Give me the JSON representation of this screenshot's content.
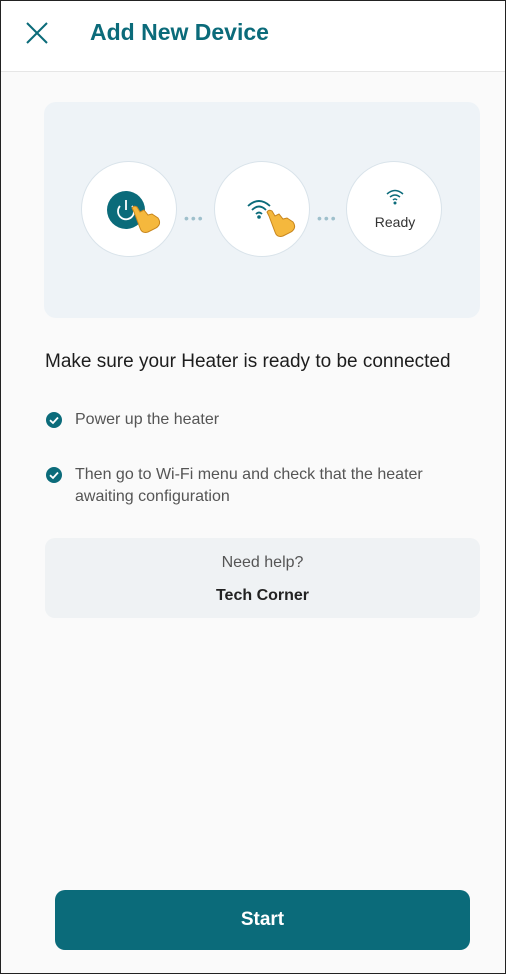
{
  "header": {
    "title": "Add New Device",
    "close_icon": "close-icon"
  },
  "illustration": {
    "steps": [
      {
        "icon": "power-icon",
        "pointer": "tap-hand-icon"
      },
      {
        "icon": "wifi-icon",
        "pointer": "tap-hand-icon"
      },
      {
        "icon": "wifi-icon",
        "label": "Ready"
      }
    ]
  },
  "instructions": {
    "heading": "Make sure your Heater is ready to be connected",
    "items": [
      "Power up the heater",
      "Then go to Wi-Fi menu and check that the heater awaiting configuration"
    ]
  },
  "help": {
    "question": "Need help?",
    "link": "Tech Corner"
  },
  "footer": {
    "start_label": "Start"
  },
  "colors": {
    "accent": "#0b6b7a",
    "hand": "#f5b83d"
  }
}
